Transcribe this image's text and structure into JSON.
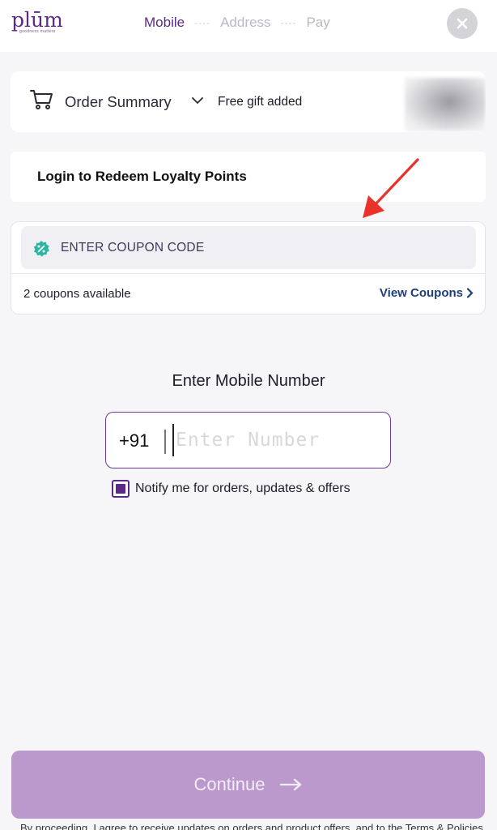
{
  "header": {
    "logo_text": "plūm",
    "logo_tagline": "goodness matters",
    "steps": [
      "Mobile",
      "Address",
      "Pay"
    ],
    "step_separator": "----",
    "active_step": 0
  },
  "summary": {
    "title": "Order Summary",
    "gift": "Free gift added"
  },
  "loyalty": {
    "label": "Login to Redeem Loyalty Points"
  },
  "coupon": {
    "placeholder": "ENTER COUPON CODE",
    "available": "2 coupons available",
    "view_label": "View Coupons"
  },
  "mobile": {
    "title": "Enter Mobile Number",
    "country_code": "+91",
    "placeholder": "Enter Number",
    "notify_label": "Notify me for orders, updates & offers",
    "notify_checked": true
  },
  "footer": {
    "continue_label": "Continue",
    "disclaimer": "By proceeding, I agree to receive updates on orders and product offers, and to the Terms & Policies"
  },
  "colors": {
    "brand": "#5b2a86",
    "continue_bg": "#bb99cd",
    "coupon_icon": "#2bb6a3",
    "link": "#1d3f7a",
    "annotation_arrow": "#e8322a"
  },
  "icons": {
    "close": "close-icon",
    "cart": "cart-icon",
    "chevron": "chevron-down-icon",
    "coupon": "discount-badge-icon",
    "arrow_right": "arrow-right-icon"
  }
}
